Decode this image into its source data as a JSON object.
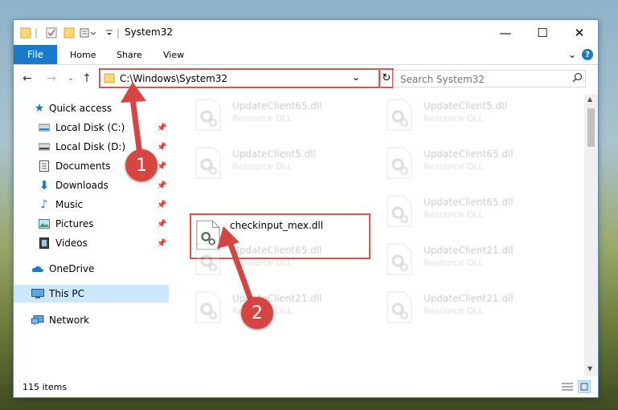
{
  "window": {
    "title": "System32",
    "controls": {
      "minimize": "—",
      "maximize": "☐",
      "close": "✕"
    }
  },
  "ribbon": {
    "file": "File",
    "tabs": [
      "Home",
      "Share",
      "View"
    ],
    "collapse": "⌄",
    "help": "?"
  },
  "address": {
    "path": "C:\\Windows\\System32",
    "dropdown": "⌄",
    "refresh": "↻"
  },
  "search": {
    "placeholder": "Search System32"
  },
  "sidebar": {
    "items": [
      {
        "label": "Quick access",
        "icon": "star-icon",
        "pinned": false
      },
      {
        "label": "Local Disk (C:)",
        "icon": "drive-icon",
        "pinned": true
      },
      {
        "label": "Local Disk (D:)",
        "icon": "drive-icon",
        "pinned": true
      },
      {
        "label": "Documents",
        "icon": "documents-icon",
        "pinned": true
      },
      {
        "label": "Downloads",
        "icon": "downloads-icon",
        "pinned": true
      },
      {
        "label": "Music",
        "icon": "music-icon",
        "pinned": true
      },
      {
        "label": "Pictures",
        "icon": "pictures-icon",
        "pinned": true
      },
      {
        "label": "Videos",
        "icon": "videos-icon",
        "pinned": true
      },
      {
        "label": "OneDrive",
        "icon": "cloud-icon",
        "pinned": false
      },
      {
        "label": "This PC",
        "icon": "computer-icon",
        "pinned": false
      },
      {
        "label": "Network",
        "icon": "network-icon",
        "pinned": false
      }
    ]
  },
  "files": [
    {
      "name": "UpdateClient65.dll",
      "type": "Resource DLL"
    },
    {
      "name": "UpdateClient5.dll",
      "type": "Resource DLL"
    },
    {
      "name": "UpdateClient5.dll",
      "type": "Resource DLL"
    },
    {
      "name": "UpdateClient65.dll",
      "type": "Resource DLL"
    },
    {
      "name": "checkinput_mex.dll",
      "type": ""
    },
    {
      "name": "UpdateClient65.dll",
      "type": "Resource DLL"
    },
    {
      "name": "UpdateClient65.dll",
      "type": "Resource DLL"
    },
    {
      "name": "UpdateClient21.dll",
      "type": "Resource DLL"
    },
    {
      "name": "UpdateClient21.dll",
      "type": "Resource DLL"
    },
    {
      "name": "UpdateClient21.dll",
      "type": "Resource DLL"
    }
  ],
  "status": {
    "count": "115 items"
  },
  "annotations": {
    "step1": "1",
    "step2": "2",
    "color": "#d64541"
  }
}
